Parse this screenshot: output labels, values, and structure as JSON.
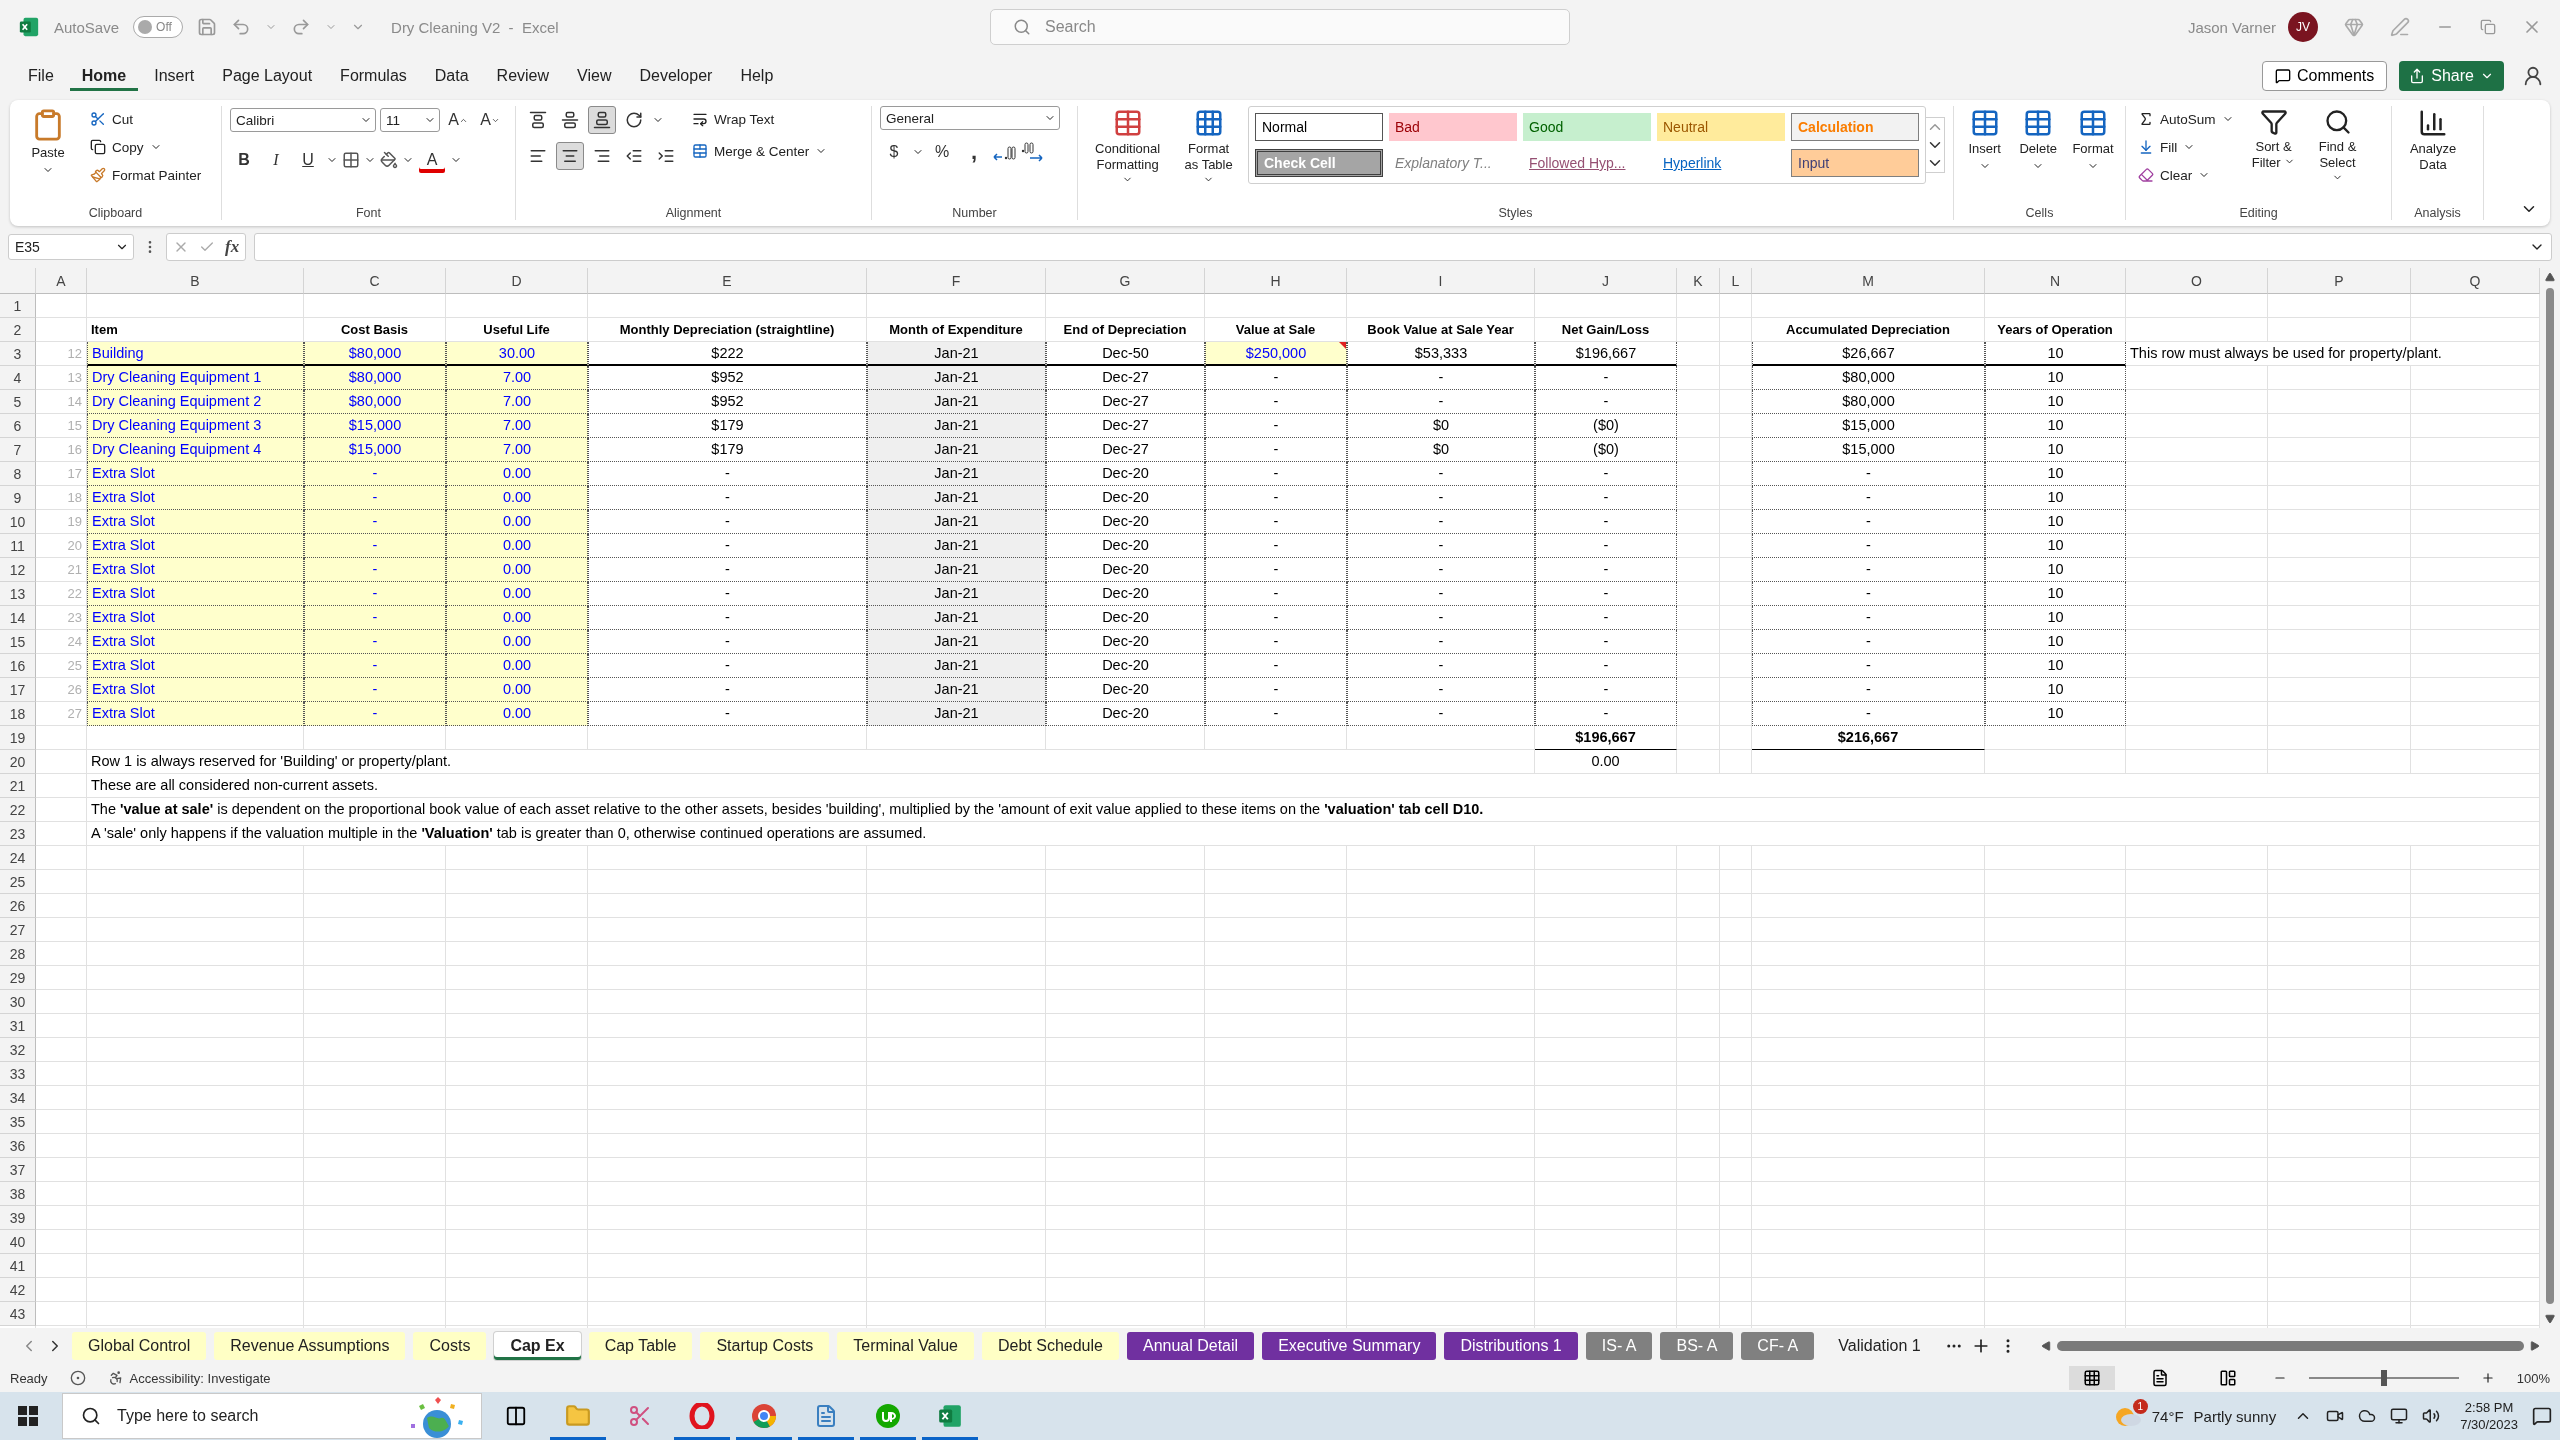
{
  "title_bar": {
    "autosave_label": "AutoSave",
    "autosave_state": "Off",
    "autosave_on": false,
    "document_title": "Dry Cleaning V2  -  Excel",
    "search_placeholder": "Search",
    "user_name": "Jason Varner",
    "user_initials": "JV"
  },
  "menu_tabs": [
    {
      "label": "File",
      "selected": false
    },
    {
      "label": "Home",
      "selected": true
    },
    {
      "label": "Insert",
      "selected": false
    },
    {
      "label": "Page Layout",
      "selected": false
    },
    {
      "label": "Formulas",
      "selected": false
    },
    {
      "label": "Data",
      "selected": false
    },
    {
      "label": "Review",
      "selected": false
    },
    {
      "label": "View",
      "selected": false
    },
    {
      "label": "Developer",
      "selected": false
    },
    {
      "label": "Help",
      "selected": false
    }
  ],
  "comments_button": "Comments",
  "share_button": "Share",
  "ribbon": {
    "clipboard": {
      "label": "Clipboard",
      "paste": "Paste",
      "cut": "Cut",
      "copy": "Copy",
      "format_painter": "Format Painter"
    },
    "font": {
      "label": "Font",
      "font_name": "Calibri",
      "font_size": "11",
      "grow_font": "A",
      "shrink_font": "A",
      "bold": "B",
      "italic": "I",
      "underline": "U",
      "font_color": "A"
    },
    "alignment": {
      "label": "Alignment",
      "wrap_text": "Wrap Text",
      "merge_center": "Merge & Center",
      "bottom_align_on": true,
      "center_on": true
    },
    "number": {
      "label": "Number",
      "format": "General",
      "currency": "$",
      "percent": "%",
      "comma": ","
    },
    "styles": {
      "label": "Styles",
      "conditional_formatting": "Conditional Formatting",
      "format_as_table": "Format as Table",
      "gallery": [
        {
          "label": "Normal",
          "kind": "normal"
        },
        {
          "label": "Bad",
          "kind": "bad"
        },
        {
          "label": "Good",
          "kind": "good"
        },
        {
          "label": "Neutral",
          "kind": "neutral"
        },
        {
          "label": "Calculation",
          "kind": "calculation"
        },
        {
          "label": "Check Cell",
          "kind": "check"
        },
        {
          "label": "Explanatory T...",
          "kind": "explanatory"
        },
        {
          "label": "Followed Hyp...",
          "kind": "followed"
        },
        {
          "label": "Hyperlink",
          "kind": "hyperlink"
        },
        {
          "label": "Input",
          "kind": "input"
        }
      ]
    },
    "cells": {
      "label": "Cells",
      "buttons": [
        "Insert",
        "Delete",
        "Format"
      ]
    },
    "editing": {
      "label": "Editing",
      "autosum": "AutoSum",
      "fill": "Fill",
      "clear": "Clear",
      "sort_filter": "Sort & Filter",
      "find_select": "Find & Select"
    },
    "analysis": {
      "label": "Analysis",
      "analyze_data": "Analyze Data"
    }
  },
  "formula_bar": {
    "name_box": "E35",
    "fx": "fx"
  },
  "sheet": {
    "column_headers": [
      "A",
      "B",
      "C",
      "D",
      "E",
      "F",
      "G",
      "H",
      "I",
      "J",
      "K",
      "L",
      "M",
      "N",
      "O",
      "P",
      "Q"
    ],
    "row_numbers": [
      "1",
      "2",
      "3",
      "4",
      "5",
      "6",
      "7",
      "8",
      "9",
      "10",
      "11",
      "12",
      "13",
      "14",
      "15",
      "16",
      "17",
      "18",
      "19",
      "20",
      "21",
      "22",
      "23",
      "24",
      "25",
      "26",
      "27",
      "28",
      "29",
      "30",
      "31",
      "32",
      "33",
      "34",
      "35",
      "36",
      "37",
      "38",
      "39",
      "40",
      "41",
      "42",
      "43"
    ],
    "assets": {
      "columns": [
        "Item",
        "Cost Basis",
        "Useful Life",
        "Monthly Depreciation (straightline)",
        "Month of Expenditure",
        "End of Depreciation",
        "Value at Sale",
        "Book Value at Sale Year",
        "Net Gain/Loss"
      ],
      "rows": [
        {
          "line_number": "12",
          "cells": [
            "Building",
            "$80,000",
            "30.00",
            "$222",
            "Jan-21",
            "Dec-50",
            "$250,000",
            "$53,333",
            "$196,667"
          ],
          "sale_input": true,
          "has_comment": true
        },
        {
          "line_number": "13",
          "cells": [
            "Dry Cleaning Equipment 1",
            "$80,000",
            "7.00",
            "$952",
            "Jan-21",
            "Dec-27",
            "-",
            "-",
            "-"
          ],
          "sale_input": false,
          "has_comment": false
        },
        {
          "line_number": "14",
          "cells": [
            "Dry Cleaning Equipment 2",
            "$80,000",
            "7.00",
            "$952",
            "Jan-21",
            "Dec-27",
            "-",
            "-",
            "-"
          ],
          "sale_input": false,
          "has_comment": false
        },
        {
          "line_number": "15",
          "cells": [
            "Dry Cleaning Equipment 3",
            "$15,000",
            "7.00",
            "$179",
            "Jan-21",
            "Dec-27",
            "-",
            "$0",
            "($0)"
          ],
          "sale_input": false,
          "has_comment": false
        },
        {
          "line_number": "16",
          "cells": [
            "Dry Cleaning Equipment 4",
            "$15,000",
            "7.00",
            "$179",
            "Jan-21",
            "Dec-27",
            "-",
            "$0",
            "($0)"
          ],
          "sale_input": false,
          "has_comment": false
        },
        {
          "line_number": "17",
          "cells": [
            "Extra Slot",
            "-",
            "0.00",
            "-",
            "Jan-21",
            "Dec-20",
            "-",
            "-",
            "-"
          ],
          "sale_input": false,
          "has_comment": false
        },
        {
          "line_number": "18",
          "cells": [
            "Extra Slot",
            "-",
            "0.00",
            "-",
            "Jan-21",
            "Dec-20",
            "-",
            "-",
            "-"
          ],
          "sale_input": false,
          "has_comment": false
        },
        {
          "line_number": "19",
          "cells": [
            "Extra Slot",
            "-",
            "0.00",
            "-",
            "Jan-21",
            "Dec-20",
            "-",
            "-",
            "-"
          ],
          "sale_input": false,
          "has_comment": false
        },
        {
          "line_number": "20",
          "cells": [
            "Extra Slot",
            "-",
            "0.00",
            "-",
            "Jan-21",
            "Dec-20",
            "-",
            "-",
            "-"
          ],
          "sale_input": false,
          "has_comment": false
        },
        {
          "line_number": "21",
          "cells": [
            "Extra Slot",
            "-",
            "0.00",
            "-",
            "Jan-21",
            "Dec-20",
            "-",
            "-",
            "-"
          ],
          "sale_input": false,
          "has_comment": false
        },
        {
          "line_number": "22",
          "cells": [
            "Extra Slot",
            "-",
            "0.00",
            "-",
            "Jan-21",
            "Dec-20",
            "-",
            "-",
            "-"
          ],
          "sale_input": false,
          "has_comment": false
        },
        {
          "line_number": "23",
          "cells": [
            "Extra Slot",
            "-",
            "0.00",
            "-",
            "Jan-21",
            "Dec-20",
            "-",
            "-",
            "-"
          ],
          "sale_input": false,
          "has_comment": false
        },
        {
          "line_number": "24",
          "cells": [
            "Extra Slot",
            "-",
            "0.00",
            "-",
            "Jan-21",
            "Dec-20",
            "-",
            "-",
            "-"
          ],
          "sale_input": false,
          "has_comment": false
        },
        {
          "line_number": "25",
          "cells": [
            "Extra Slot",
            "-",
            "0.00",
            "-",
            "Jan-21",
            "Dec-20",
            "-",
            "-",
            "-"
          ],
          "sale_input": false,
          "has_comment": false
        },
        {
          "line_number": "26",
          "cells": [
            "Extra Slot",
            "-",
            "0.00",
            "-",
            "Jan-21",
            "Dec-20",
            "-",
            "-",
            "-"
          ],
          "sale_input": false,
          "has_comment": false
        },
        {
          "line_number": "27",
          "cells": [
            "Extra Slot",
            "-",
            "0.00",
            "-",
            "Jan-21",
            "Dec-20",
            "-",
            "-",
            "-"
          ],
          "sale_input": false,
          "has_comment": false
        }
      ]
    },
    "accumulated": {
      "columns": [
        "Accumulated Depreciation",
        "Years of Operation"
      ],
      "rows": [
        [
          "$26,667",
          "10"
        ],
        [
          "$80,000",
          "10"
        ],
        [
          "$80,000",
          "10"
        ],
        [
          "$15,000",
          "10"
        ],
        [
          "$15,000",
          "10"
        ],
        [
          "-",
          "10"
        ],
        [
          "-",
          "10"
        ],
        [
          "-",
          "10"
        ],
        [
          "-",
          "10"
        ],
        [
          "-",
          "10"
        ],
        [
          "-",
          "10"
        ],
        [
          "-",
          "10"
        ],
        [
          "-",
          "10"
        ],
        [
          "-",
          "10"
        ],
        [
          "-",
          "10"
        ],
        [
          "-",
          "10"
        ]
      ]
    },
    "row_note": "This row must always be used for property/plant.",
    "net_total": "$196,667",
    "net_check": "0.00",
    "accumulated_total": "$216,667",
    "notes": [
      "Row 1 is always reserved for 'Building' or property/plant.",
      "These are all considered non-current assets.",
      "The **'value at sale'** is dependent on the proportional book value of each asset relative to the other assets, besides 'building', multiplied by the 'amount of exit value applied to these items on the **'valuation' tab cell D10.**",
      "A 'sale' only happens if the valuation multiple in the **'Valuation'** tab is greater than 0, otherwise continued operations are assumed."
    ]
  },
  "sheet_tabs": [
    {
      "label": "Global Control",
      "color": "#ffffc5",
      "selected": false
    },
    {
      "label": "Revenue Assumptions",
      "color": "#ffffc5",
      "selected": false
    },
    {
      "label": "Costs",
      "color": "#ffffc5",
      "selected": false
    },
    {
      "label": "Cap Ex",
      "selected": true
    },
    {
      "label": "Cap Table",
      "color": "#ffffc5",
      "selected": false
    },
    {
      "label": "Startup Costs",
      "color": "#ffffc5",
      "selected": false
    },
    {
      "label": "Terminal Value",
      "color": "#ffffc5",
      "selected": false
    },
    {
      "label": "Debt Schedule",
      "color": "#ffffc5",
      "selected": false
    },
    {
      "label": "Annual Detail",
      "color": "#7030a0",
      "selected": false
    },
    {
      "label": "Executive Summary",
      "color": "#7030a0",
      "selected": false
    },
    {
      "label": "Distributions 1",
      "color": "#7030a0",
      "selected": false
    },
    {
      "label": "IS- A",
      "color": "#808080",
      "selected": false
    },
    {
      "label": "BS- A",
      "color": "#808080",
      "selected": false
    },
    {
      "label": "CF- A",
      "color": "#808080",
      "selected": false
    },
    {
      "label": "Validation 1",
      "selected": false
    }
  ],
  "status_bar": {
    "mode": "Ready",
    "accessibility": "Accessibility: Investigate",
    "zoom": "100%",
    "zoom_level": {
      "level": 0.5
    }
  },
  "taskbar": {
    "search_placeholder": "Type here to search",
    "weather_badge": "1",
    "temperature": "74°F",
    "weather": "Partly sunny",
    "time": "2:58 PM",
    "date": "7/30/2023"
  }
}
